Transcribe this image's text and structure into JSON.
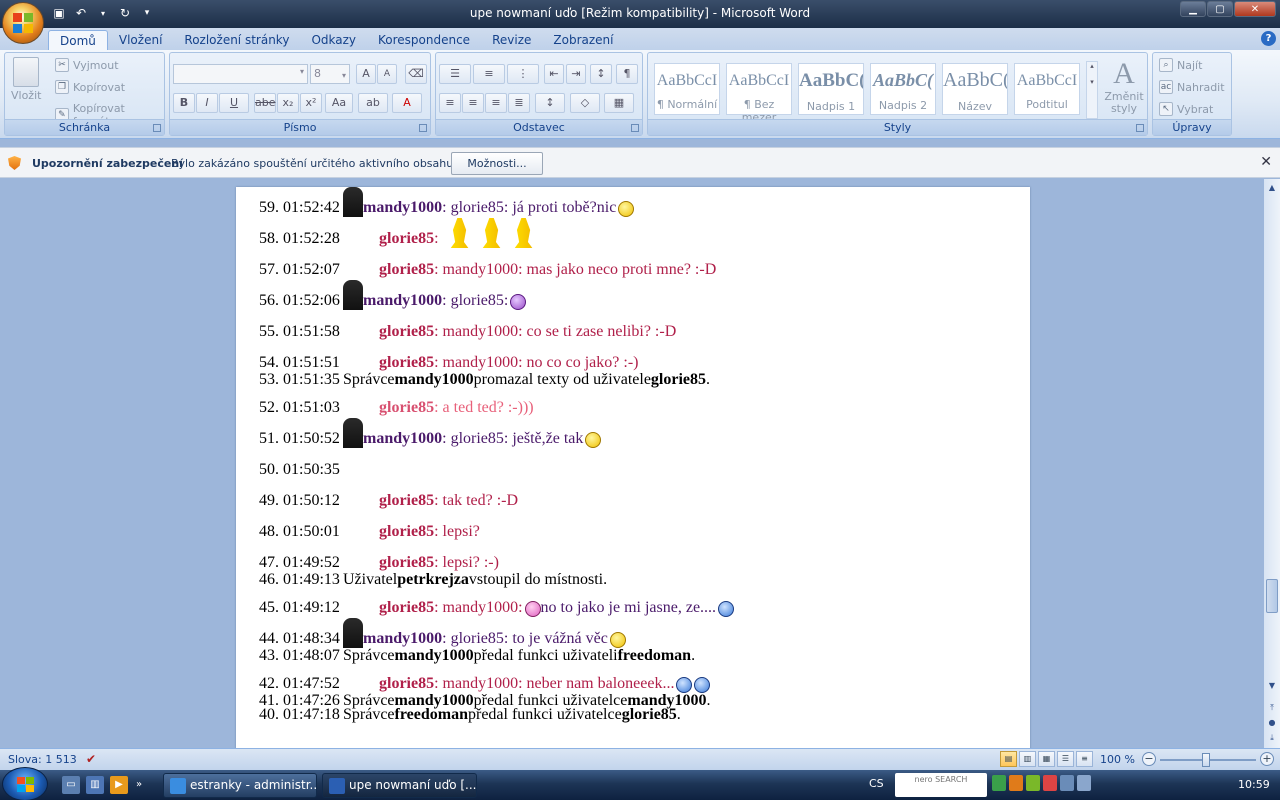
{
  "window": {
    "title": "upe nowmaní uďo [Režim kompatibility] - Microsoft Word"
  },
  "tabs": [
    "Domů",
    "Vložení",
    "Rozložení stránky",
    "Odkazy",
    "Korespondence",
    "Revize",
    "Zobrazení"
  ],
  "active_tab": "Domů",
  "ribbon": {
    "clipboard": {
      "label": "Schránka",
      "paste": "Vložit",
      "cut": "Vyjmout",
      "copy": "Kopírovat",
      "format_painter": "Kopírovat formát"
    },
    "font": {
      "label": "Písmo",
      "font_name": "",
      "font_size": "8"
    },
    "paragraph": {
      "label": "Odstavec"
    },
    "styles": {
      "label": "Styly",
      "items": [
        {
          "sample": "AaBbCcI",
          "name": "¶ Normální"
        },
        {
          "sample": "AaBbCcI",
          "name": "¶ Bez mezer"
        },
        {
          "sample": "AaBbC(",
          "name": "Nadpis 1"
        },
        {
          "sample": "AaBbC(",
          "name": "Nadpis 2"
        },
        {
          "sample": "AaBbC(",
          "name": "Název"
        },
        {
          "sample": "AaBbCcI",
          "name": "Podtitul"
        }
      ],
      "change_styles": "Změnit styly"
    },
    "editing": {
      "label": "Úpravy",
      "find": "Najít",
      "replace": "Nahradit",
      "select": "Vybrat"
    }
  },
  "security_bar": {
    "title": "Upozornění zabezpečení",
    "message": "Bylo zakázáno spouštění určitého aktivního obsahu.",
    "options_button": "Možnosti..."
  },
  "document": {
    "lines": [
      {
        "num": "59. 01:52:42",
        "user": "mandy1000",
        "text": ": glorie85: já proti tobě?nic"
      },
      {
        "num": "58. 01:52:28",
        "user": "glorie85",
        "text": ":"
      },
      {
        "num": "57. 01:52:07",
        "user": "glorie85",
        "text": ": mandy1000: mas jako neco proti mne? :-D"
      },
      {
        "num": "56. 01:52:06",
        "user": "mandy1000",
        "text": ": glorie85:"
      },
      {
        "num": "55. 01:51:58",
        "user": "glorie85",
        "text": ": mandy1000: co se ti zase nelibi? :-D"
      },
      {
        "num": "54. 01:51:51",
        "user": "glorie85",
        "text": ": mandy1000: no co co jako? :-)"
      },
      {
        "num": "53. 01:51:35",
        "system": [
          "Správce ",
          "mandy1000",
          " promazal texty od uživatele ",
          "glorie85",
          "."
        ]
      },
      {
        "num": "52. 01:51:03",
        "user": "glorie85",
        "text": ": a ted ted? :-)))"
      },
      {
        "num": "51. 01:50:52",
        "user": "mandy1000",
        "text": ": glorie85: ještě,že tak"
      },
      {
        "num": "50. 01:50:35",
        "user": "",
        "text": ""
      },
      {
        "num": "49. 01:50:12",
        "user": "glorie85",
        "text": ": tak ted? :-D"
      },
      {
        "num": "48. 01:50:01",
        "user": "glorie85",
        "text": ": lepsi?"
      },
      {
        "num": "47. 01:49:52",
        "user": "glorie85",
        "text": ": lepsi? :-)"
      },
      {
        "num": "46. 01:49:13",
        "system": [
          "Uživatel ",
          "petrkrejza",
          " vstoupil do místnosti",
          "",
          "."
        ]
      },
      {
        "num": "45. 01:49:12",
        "user": "glorie85",
        "text": ": mandy1000:",
        "text2": "no to jako je mi jasne, ze...."
      },
      {
        "num": "44. 01:48:34",
        "user": "mandy1000",
        "text": ": glorie85: to je vážná věc"
      },
      {
        "num": "43. 01:48:07",
        "system": [
          "Správce ",
          "mandy1000",
          " předal funkci uživateli ",
          "freedoman",
          "."
        ]
      },
      {
        "num": "42. 01:47:52",
        "user": "glorie85",
        "text": ": mandy1000: neber nam baloneeek..."
      },
      {
        "num": "41. 01:47:26",
        "system": [
          "Správce ",
          "mandy1000",
          " předal funkci uživatelce ",
          "mandy1000",
          "."
        ]
      },
      {
        "num": "40. 01:47:18",
        "system": [
          "Správce ",
          "freedoman",
          " předal funkci uživatelce ",
          "glorie85",
          "."
        ]
      }
    ]
  },
  "status": {
    "words": "Slova: 1 513",
    "zoom": "100 %"
  },
  "taskbar": {
    "tasks": [
      "estranky - administr...",
      "upe nowmaní uďo [..."
    ],
    "lang": "CS",
    "nero": "nero SEARCH",
    "clock": "10:59"
  }
}
